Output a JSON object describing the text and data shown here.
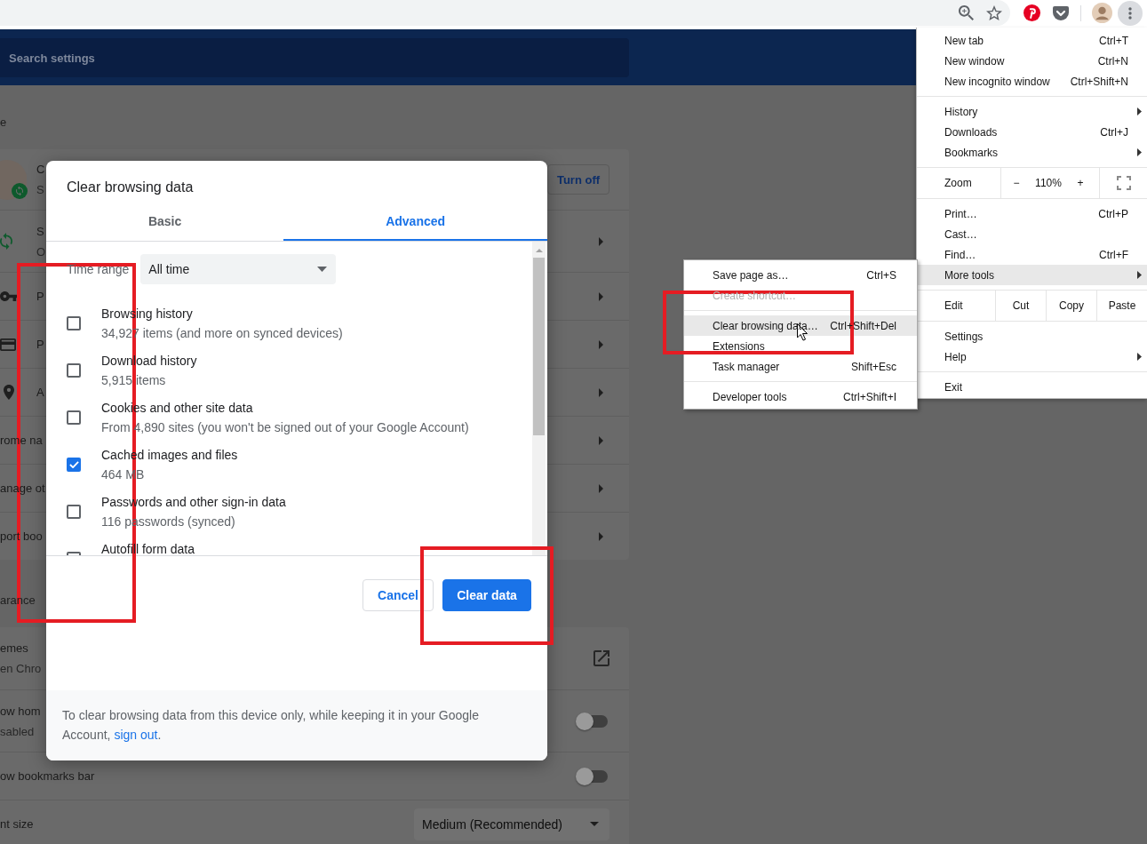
{
  "toolbar": {
    "menu_button_active": true
  },
  "settings": {
    "search": {
      "placeholder": "Search settings"
    },
    "sections": [
      {
        "title": "e",
        "rows": [
          {
            "kind": "account",
            "title": "C",
            "subtitle": "S",
            "button": "Turn off"
          },
          {
            "kind": "icon_link",
            "title": "S",
            "subtitle": "O"
          },
          {
            "kind": "icon_link",
            "title": "P"
          },
          {
            "kind": "icon_link",
            "title": "P"
          },
          {
            "kind": "icon_link",
            "title": "A"
          },
          {
            "kind": "link",
            "title": "rome na"
          },
          {
            "kind": "link",
            "title": "anage ot"
          },
          {
            "kind": "link",
            "title": "port boo"
          }
        ]
      },
      {
        "title": "arance",
        "rows": [
          {
            "kind": "external",
            "title": "emes",
            "subtitle": "en Chro"
          },
          {
            "kind": "toggle",
            "title": "ow hom",
            "subtitle": "sabled",
            "on": false
          },
          {
            "kind": "toggle",
            "title": "ow bookmarks bar",
            "on": false
          },
          {
            "kind": "select",
            "title": "nt size",
            "value": "Medium (Recommended)"
          }
        ]
      }
    ]
  },
  "dialog": {
    "title": "Clear browsing data",
    "tabs": [
      {
        "label": "Basic",
        "selected": false
      },
      {
        "label": "Advanced",
        "selected": true
      }
    ],
    "time_range": {
      "label": "Time range",
      "value": "All time"
    },
    "items": [
      {
        "label": "Browsing history",
        "detail": "34,927 items (and more on synced devices)",
        "checked": false
      },
      {
        "label": "Download history",
        "detail": "5,915 items",
        "checked": false
      },
      {
        "label": "Cookies and other site data",
        "detail": "From 4,890 sites (you won't be signed out of your Google Account)",
        "checked": false
      },
      {
        "label": "Cached images and files",
        "detail": "464 MB",
        "checked": true
      },
      {
        "label": "Passwords and other sign-in data",
        "detail": "116 passwords (synced)",
        "checked": false
      },
      {
        "label": "Autofill form data",
        "checked": false
      }
    ],
    "buttons": [
      {
        "label": "Cancel",
        "kind": "secondary"
      },
      {
        "label": "Clear data",
        "kind": "primary"
      }
    ],
    "footer": {
      "text": "To clear browsing data from this device only, while keeping it in your Google Account, ",
      "link": "sign out",
      "end": "."
    }
  },
  "app_menu": {
    "groups": [
      [
        {
          "kind": "item",
          "label": "New tab",
          "shortcut": "Ctrl+T",
          "submenu": false,
          "selected": false
        },
        {
          "kind": "item",
          "label": "New window",
          "shortcut": "Ctrl+N",
          "submenu": false,
          "selected": false
        },
        {
          "kind": "item",
          "label": "New incognito window",
          "shortcut": "Ctrl+Shift+N",
          "submenu": false,
          "selected": false
        }
      ],
      [
        {
          "kind": "item",
          "label": "History",
          "submenu": true,
          "selected": false
        },
        {
          "kind": "item",
          "label": "Downloads",
          "shortcut": "Ctrl+J",
          "submenu": false,
          "selected": false
        },
        {
          "kind": "item",
          "label": "Bookmarks",
          "submenu": true,
          "selected": false
        }
      ],
      [
        {
          "kind": "zoom",
          "label": "Zoom",
          "minus": "−",
          "value": "110%",
          "plus": "+"
        }
      ],
      [
        {
          "kind": "item",
          "label": "Print…",
          "shortcut": "Ctrl+P",
          "submenu": false,
          "selected": false
        },
        {
          "kind": "item",
          "label": "Cast…",
          "submenu": false,
          "selected": false
        },
        {
          "kind": "item",
          "label": "Find…",
          "shortcut": "Ctrl+F",
          "submenu": false,
          "selected": false
        },
        {
          "kind": "item",
          "label": "More tools",
          "submenu": true,
          "selected": true
        }
      ],
      [
        {
          "kind": "edit",
          "label": "Edit",
          "actions": [
            "Cut",
            "Copy",
            "Paste"
          ]
        }
      ],
      [
        {
          "kind": "item",
          "label": "Settings",
          "submenu": false,
          "selected": false
        },
        {
          "kind": "item",
          "label": "Help",
          "submenu": true,
          "selected": false
        }
      ],
      [
        {
          "kind": "item",
          "label": "Exit",
          "submenu": false,
          "selected": false
        }
      ]
    ]
  },
  "more_tools_menu": {
    "groups": [
      [
        {
          "kind": "item",
          "label": "Save page as…",
          "shortcut": "Ctrl+S",
          "selected": false,
          "disabled": false
        },
        {
          "kind": "item",
          "label": "Create shortcut…",
          "selected": false,
          "disabled": true
        }
      ],
      [
        {
          "kind": "item",
          "label": "Clear browsing data…",
          "shortcut": "Ctrl+Shift+Del",
          "selected": true,
          "disabled": false
        },
        {
          "kind": "item",
          "label": "Extensions",
          "selected": false,
          "disabled": false
        },
        {
          "kind": "item",
          "label": "Task manager",
          "shortcut": "Shift+Esc",
          "selected": false,
          "disabled": false
        }
      ],
      [
        {
          "kind": "item",
          "label": "Developer tools",
          "shortcut": "Ctrl+Shift+I",
          "selected": false,
          "disabled": false
        }
      ]
    ]
  }
}
